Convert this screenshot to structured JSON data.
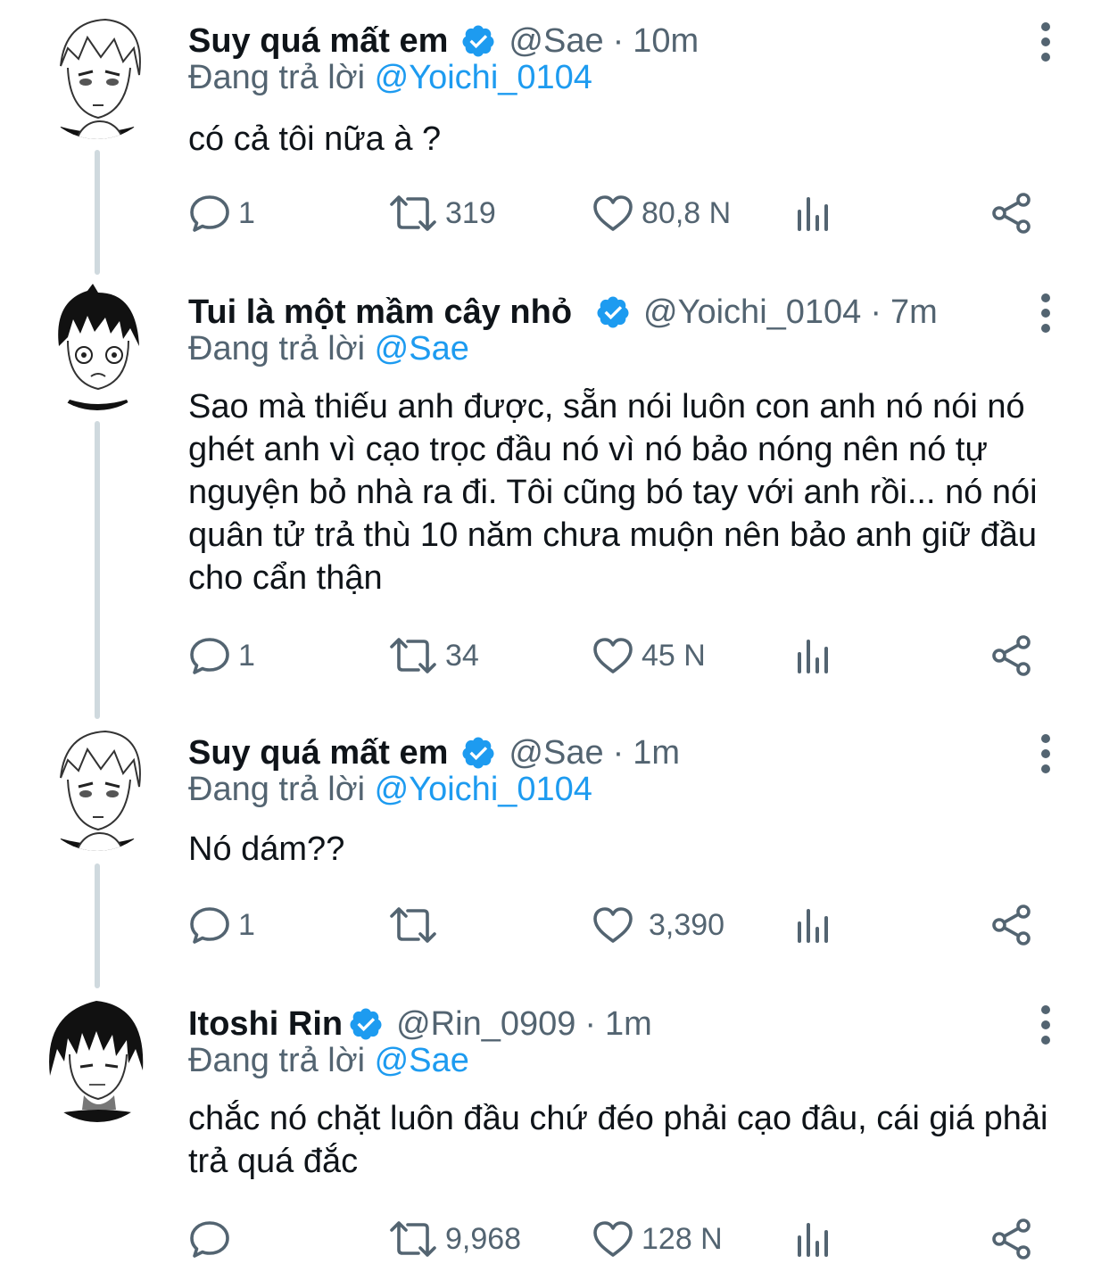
{
  "colors": {
    "text": "#0f1419",
    "secondary": "#536471",
    "accent": "#1d9bf0",
    "thread_line": "#cfd9de"
  },
  "reply_prefix": "Đang trả lời ",
  "tweets": [
    {
      "name": "Suy quá mất em",
      "verified": true,
      "handle": "@Sae",
      "separator": "·",
      "time": "10m",
      "reply_to": "@Yoichi_0104",
      "text": "có cả tôi nữa à ?",
      "replies": "1",
      "retweets": "319",
      "likes": "80,8 N"
    },
    {
      "name": "Tui là một mầm cây nhỏ",
      "verified": true,
      "handle": "@Yoichi_0104",
      "separator": "·",
      "time": "7m",
      "reply_to": "@Sae",
      "text": "Sao mà thiếu anh được, sẵn nói luôn  con anh nó nói nó ghét anh vì cạo trọc đầu nó vì nó bảo nóng nên nó tự nguyện bỏ nhà ra đi. Tôi cũng bó tay với anh rồi... nó nói quân tử trả thù 10 năm chưa muộn nên bảo anh giữ đầu cho cẩn thận",
      "replies": "1",
      "retweets": "34",
      "likes": "45 N"
    },
    {
      "name": "Suy quá mất em",
      "verified": true,
      "handle": "@Sae",
      "separator": "·",
      "time": "1m",
      "reply_to": "@Yoichi_0104",
      "text": "Nó dám??",
      "replies": "1",
      "retweets": "",
      "likes": "3,390"
    },
    {
      "name": "Itoshi Rin",
      "verified": true,
      "handle": "@Rin_0909",
      "separator": "·",
      "time": "1m",
      "reply_to": "@Sae",
      "text": "chắc nó chặt luôn đầu chứ đéo phải cạo đâu, cái giá phải trả quá đắc",
      "replies": "",
      "retweets": "9,968",
      "likes": "128 N"
    }
  ],
  "icons": {
    "reply": "reply-icon",
    "retweet": "retweet-icon",
    "like": "heart-icon",
    "views": "analytics-icon",
    "share": "share-icon",
    "more": "more-icon",
    "verified": "verified-badge-icon"
  }
}
